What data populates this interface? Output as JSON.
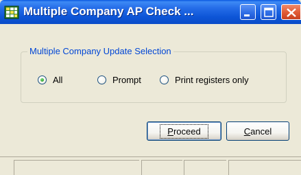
{
  "window": {
    "title": "Multiple Company AP Check ...",
    "accent": "#0a4cc8",
    "icons": {
      "app": "app-grid-icon",
      "minimize": "minimize-icon",
      "maximize": "maximize-icon",
      "close": "close-icon"
    }
  },
  "group": {
    "label": "Multiple Company Update Selection",
    "options": [
      {
        "label": "All",
        "checked": true
      },
      {
        "label": "Prompt",
        "checked": false
      },
      {
        "label": "Print registers only",
        "checked": false
      }
    ]
  },
  "buttons": {
    "proceed": {
      "underline": "P",
      "rest": "roceed"
    },
    "cancel": {
      "underline": "C",
      "rest": "ancel"
    }
  }
}
